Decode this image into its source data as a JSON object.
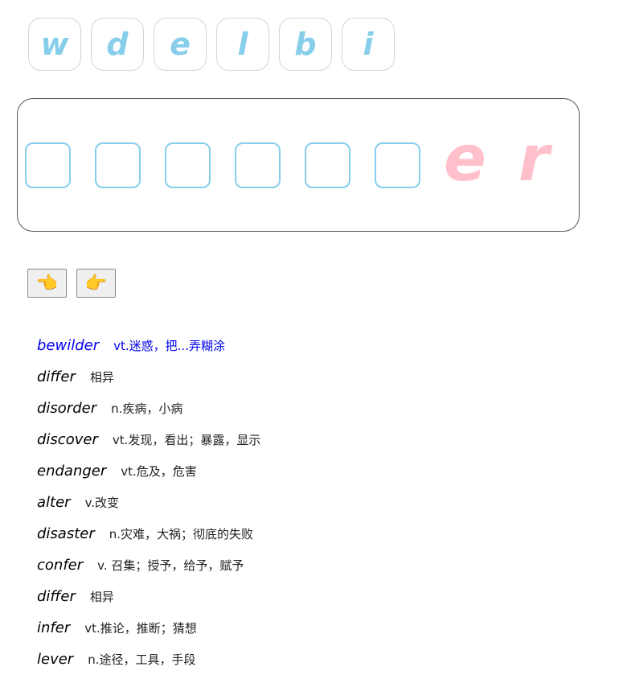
{
  "letter_tiles": [
    "w",
    "d",
    "e",
    "l",
    "b",
    "i"
  ],
  "answer_slot_count": 6,
  "suffix_letters": [
    "e",
    "r"
  ],
  "nav": {
    "prev_icon": "hand-pointing-left-icon",
    "prev_glyph": "👈",
    "next_icon": "hand-pointing-right-icon",
    "next_glyph": "👉"
  },
  "word_list": [
    {
      "word": "bewilder",
      "meaning": "vt.迷惑，把...弄糊涂",
      "active": true
    },
    {
      "word": "differ",
      "meaning": "相异",
      "active": false
    },
    {
      "word": "disorder",
      "meaning": "n.疾病，小病",
      "active": false
    },
    {
      "word": "discover",
      "meaning": "vt.发现，看出；暴露，显示",
      "active": false
    },
    {
      "word": "endanger",
      "meaning": "vt.危及，危害",
      "active": false
    },
    {
      "word": "alter",
      "meaning": "v.改变",
      "active": false
    },
    {
      "word": "disaster",
      "meaning": "n.灾难，大祸；彻底的失败",
      "active": false
    },
    {
      "word": "confer",
      "meaning": "v. 召集；授予，给予，赋予",
      "active": false
    },
    {
      "word": "differ",
      "meaning": "相异",
      "active": false
    },
    {
      "word": "infer",
      "meaning": "vt.推论，推断；猜想",
      "active": false
    },
    {
      "word": "lever",
      "meaning": "n.途径，工具，手段",
      "active": false
    }
  ],
  "colors": {
    "tile_letter": "#87ceeb",
    "slot_border": "#87ceeb",
    "suffix": "#ffc0cb",
    "active_word": "#0000ee"
  }
}
